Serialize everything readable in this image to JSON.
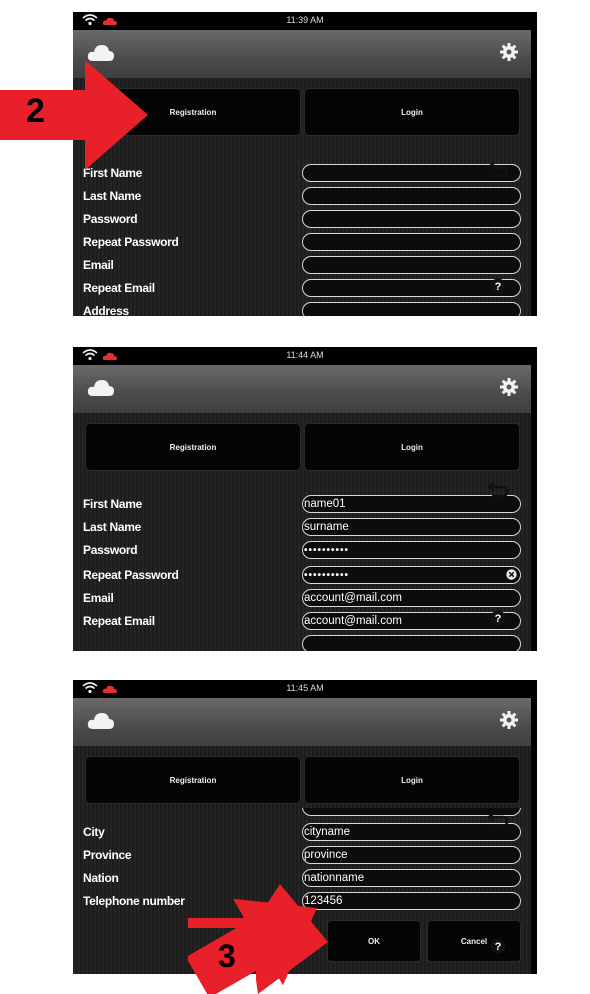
{
  "screen1": {
    "time": "11:39 AM",
    "tabs": {
      "registration": "Registration",
      "login": "Login"
    },
    "fields": [
      {
        "label": "First Name",
        "value": ""
      },
      {
        "label": "Last Name",
        "value": ""
      },
      {
        "label": "Password",
        "value": ""
      },
      {
        "label": "Repeat Password",
        "value": ""
      },
      {
        "label": "Email",
        "value": ""
      },
      {
        "label": "Repeat Email",
        "value": ""
      },
      {
        "label": "Address",
        "value": ""
      }
    ],
    "marker": "2"
  },
  "screen2": {
    "time": "11:44 AM",
    "tabs": {
      "registration": "Registration",
      "login": "Login"
    },
    "fields": [
      {
        "label": "First Name",
        "value": "name01"
      },
      {
        "label": "Last Name",
        "value": "surname"
      },
      {
        "label": "Password",
        "value": "••••••••••"
      },
      {
        "label": "Repeat Password",
        "value": "••••••••••"
      },
      {
        "label": "Email",
        "value": "account@mail.com"
      },
      {
        "label": "Repeat Email",
        "value": "account@mail.com"
      }
    ]
  },
  "screen3": {
    "time": "11:45 AM",
    "tabs": {
      "registration": "Registration",
      "login": "Login"
    },
    "fields": [
      {
        "label": "City",
        "value": "cityname"
      },
      {
        "label": "Province",
        "value": "province"
      },
      {
        "label": "Nation",
        "value": "nationname"
      },
      {
        "label": "Telephone number",
        "value": "123456"
      }
    ],
    "buttons": {
      "ok": "OK",
      "cancel": "Cancel"
    },
    "marker": "3"
  },
  "icons": [
    "wifi-icon",
    "cloud-icon",
    "gear-icon",
    "back-icon",
    "help-icon",
    "clear-icon"
  ],
  "colors": {
    "marker_red": "#e8202a",
    "header_gray": "#5a5a5a",
    "panel_black": "#000000"
  }
}
